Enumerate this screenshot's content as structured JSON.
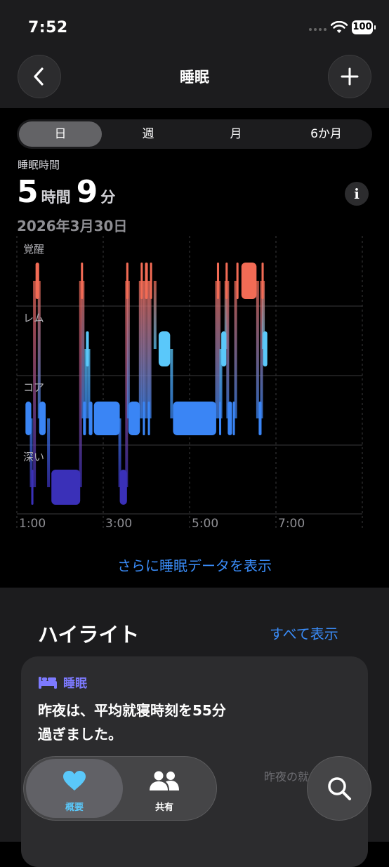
{
  "status_bar": {
    "time": "7:52",
    "battery": "100"
  },
  "nav": {
    "title": "睡眠"
  },
  "segments": [
    {
      "label": "日",
      "selected": true
    },
    {
      "label": "週",
      "selected": false
    },
    {
      "label": "月",
      "selected": false
    },
    {
      "label": "6か月",
      "selected": false
    }
  ],
  "metric": {
    "label": "睡眠時間",
    "hours": "5",
    "hours_unit": "時間",
    "minutes": "9",
    "minutes_unit": "分",
    "date": "2026年3月30日"
  },
  "chart_data": {
    "type": "sleep-stages",
    "stages": [
      "覚醒",
      "レム",
      "コア",
      "深い"
    ],
    "x_ticks": [
      "1:00",
      "3:00",
      "5:00",
      "7:00"
    ],
    "x_range": [
      "1:00",
      "8:40"
    ],
    "colors": {
      "awake": "#f26b55",
      "rem": "#5ac8fa",
      "core": "#3a85f5",
      "deep": "#3a30b8"
    },
    "segments": [
      {
        "stage": "コア",
        "start": "1:12",
        "end": "1:20"
      },
      {
        "stage": "深い",
        "start": "1:20",
        "end": "1:23"
      },
      {
        "stage": "覚醒",
        "start": "1:26",
        "end": "1:31"
      },
      {
        "stage": "コア",
        "start": "1:31",
        "end": "1:40"
      },
      {
        "stage": "深い",
        "start": "1:48",
        "end": "2:28"
      },
      {
        "stage": "覚醒",
        "start": "2:29",
        "end": "2:32"
      },
      {
        "stage": "コア",
        "start": "2:32",
        "end": "2:36"
      },
      {
        "stage": "レム",
        "start": "2:36",
        "end": "2:40"
      },
      {
        "stage": "コア",
        "start": "2:40",
        "end": "2:45"
      },
      {
        "stage": "コア",
        "start": "2:47",
        "end": "3:23"
      },
      {
        "stage": "深い",
        "start": "3:23",
        "end": "3:33"
      },
      {
        "stage": "覚醒",
        "start": "3:32",
        "end": "3:35"
      },
      {
        "stage": "コア",
        "start": "3:35",
        "end": "3:51"
      },
      {
        "stage": "覚醒",
        "start": "3:52",
        "end": "3:55"
      },
      {
        "stage": "コア",
        "start": "3:55",
        "end": "3:58"
      },
      {
        "stage": "覚醒",
        "start": "3:58",
        "end": "4:02"
      },
      {
        "stage": "コア",
        "start": "4:02",
        "end": "4:05"
      },
      {
        "stage": "覚醒",
        "start": "4:05",
        "end": "4:07"
      },
      {
        "stage": "レム",
        "start": "4:17",
        "end": "4:33"
      },
      {
        "stage": "コア",
        "start": "4:37",
        "end": "5:37"
      },
      {
        "stage": "覚醒",
        "start": "5:38",
        "end": "5:41"
      },
      {
        "stage": "コア",
        "start": "5:41",
        "end": "5:43"
      },
      {
        "stage": "レム",
        "start": "5:44",
        "end": "5:51"
      },
      {
        "stage": "覚醒",
        "start": "5:50",
        "end": "5:53"
      },
      {
        "stage": "コア",
        "start": "5:53",
        "end": "5:59"
      },
      {
        "stage": "コア",
        "start": "6:00",
        "end": "6:03"
      },
      {
        "stage": "覚醒",
        "start": "6:05",
        "end": "6:08"
      },
      {
        "stage": "覚醒",
        "start": "6:12",
        "end": "6:33"
      },
      {
        "stage": "コア",
        "start": "6:36",
        "end": "6:40"
      },
      {
        "stage": "覚醒",
        "start": "6:40",
        "end": "6:43"
      },
      {
        "stage": "レム",
        "start": "6:42",
        "end": "6:48"
      }
    ]
  },
  "more_link": "さらに睡眠データを表示",
  "highlights": {
    "title": "ハイライト",
    "show_all": "すべて表示",
    "card": {
      "category": "睡眠",
      "line1": "昨夜は、平均就寝時刻を55分",
      "line2": "過ぎました。",
      "faded": "昨夜の就"
    }
  },
  "tabbar": {
    "summary": "概要",
    "sharing": "共有"
  }
}
